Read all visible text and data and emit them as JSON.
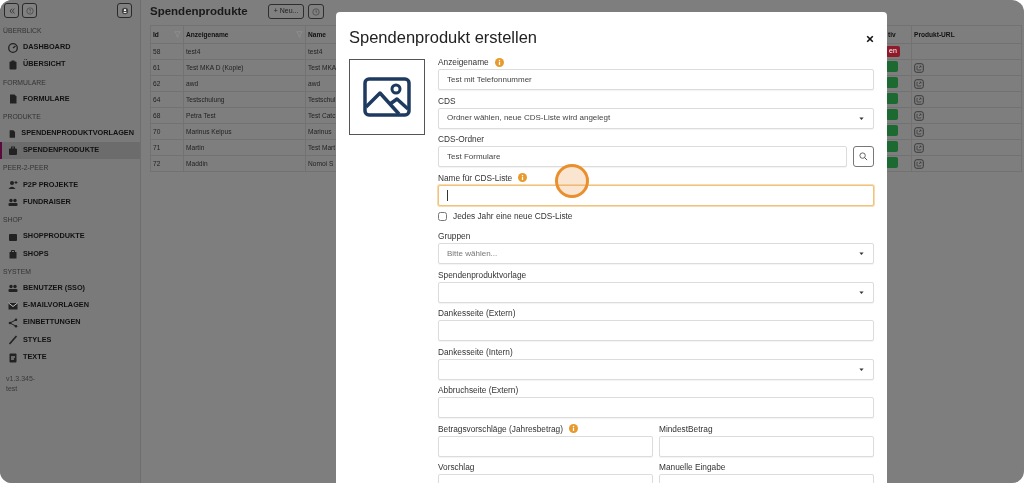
{
  "sidebar": {
    "sections": [
      {
        "title": "ÜBERBLICK",
        "items": [
          {
            "label": "DASHBOARD",
            "selected": false
          },
          {
            "label": "ÜBERSICHT",
            "selected": false
          }
        ]
      },
      {
        "title": "FORMULARE",
        "items": [
          {
            "label": "FORMULARE",
            "selected": false
          }
        ]
      },
      {
        "title": "PRODUKTE",
        "items": [
          {
            "label": "SPENDENPRODUKTVORLAGEN",
            "selected": false
          },
          {
            "label": "SPENDENPRODUKTE",
            "selected": true
          }
        ]
      },
      {
        "title": "PEER-2-PEER",
        "items": [
          {
            "label": "P2P PROJEKTE",
            "selected": false
          },
          {
            "label": "FUNDRAISER",
            "selected": false
          }
        ]
      },
      {
        "title": "SHOP",
        "items": [
          {
            "label": "SHOPPRODUKTE",
            "selected": false
          },
          {
            "label": "SHOPS",
            "selected": false
          }
        ]
      },
      {
        "title": "SYSTEM",
        "items": [
          {
            "label": "BENUTZER (SSO)",
            "selected": false
          },
          {
            "label": "E-MAILVORLAGEN",
            "selected": false
          },
          {
            "label": "EINBETTUNGEN",
            "selected": false
          },
          {
            "label": "STYLES",
            "selected": false
          },
          {
            "label": "TEXTE",
            "selected": false
          }
        ]
      }
    ],
    "version": "v1.3.345-test"
  },
  "main": {
    "title": "Spendenprodukte",
    "new_button": "+ Neu...",
    "table": {
      "columns": [
        {
          "label": "Id",
          "filter": true
        },
        {
          "label": "Anzeigename",
          "filter": true
        },
        {
          "label": "Name"
        },
        {
          "label": "tiv",
          "filter": false
        },
        {
          "label": "Produkt-URL",
          "filter": false
        }
      ],
      "rows": [
        {
          "id": "58",
          "display_name": "test4",
          "name": "test4",
          "status": {
            "text": "en",
            "color": "#8e1a2a"
          },
          "link": false
        },
        {
          "id": "61",
          "display_name": "Test MKA D (Kopie)",
          "name": "Test MKA",
          "status": {
            "color": "#1c6a32"
          },
          "link": true
        },
        {
          "id": "62",
          "display_name": "awd",
          "name": "awd",
          "status": {
            "color": "#1c6a32"
          },
          "link": true
        },
        {
          "id": "64",
          "display_name": "Testschulung",
          "name": "Testschul",
          "status": {
            "color": "#1c6a32"
          },
          "link": true
        },
        {
          "id": "68",
          "display_name": "Petra Test",
          "name": "Test Catc",
          "status": {
            "color": "#1c6a32"
          },
          "link": true
        },
        {
          "id": "70",
          "display_name": "Marinus Keipus",
          "name": "Marinus",
          "status": {
            "color": "#1c6a32"
          },
          "link": true
        },
        {
          "id": "71",
          "display_name": "Martin",
          "name": "Test Mart",
          "status": {
            "color": "#1c6a32"
          },
          "link": true
        },
        {
          "id": "72",
          "display_name": "Maddin",
          "name": "Nomoi S",
          "status": {
            "color": "#1c6a32"
          },
          "link": true
        }
      ]
    }
  },
  "modal": {
    "title": "Spendenprodukt erstellen",
    "fields": [
      {
        "kind": "text",
        "label": "Anzeigename",
        "info": true,
        "value": "Test mit Telefonnummer"
      },
      {
        "kind": "select",
        "label": "CDS",
        "info": false,
        "value": "Ordner wählen, neue CDS-Liste wird angelegt"
      },
      {
        "kind": "search",
        "label": "CDS-Ordner",
        "info": false,
        "value": "Test Formulare"
      },
      {
        "kind": "text",
        "label": "Name für CDS-Liste",
        "info": true,
        "focused": true
      },
      {
        "kind": "checkbox",
        "label": "Jedes Jahr eine neue CDS-Liste",
        "checked": false
      },
      {
        "kind": "select",
        "label": "Gruppen",
        "info": false,
        "placeholder": "Bitte wählen..."
      },
      {
        "kind": "select",
        "label": "Spendenproduktvorlage",
        "info": false
      },
      {
        "kind": "text",
        "label": "Dankesseite (Extern)",
        "info": false
      },
      {
        "kind": "select",
        "label": "Dankesseite (Intern)",
        "info": false
      },
      {
        "kind": "text",
        "label": "Abbruchseite (Extern)",
        "info": false
      },
      {
        "kind": "pair",
        "fields": [
          {
            "kind": "text",
            "label": "Betragsvorschläge (Jahresbetrag)",
            "info": true
          },
          {
            "kind": "text",
            "label": "MindestBetrag",
            "info": false
          }
        ]
      },
      {
        "kind": "pair",
        "fields": [
          {
            "kind": "text",
            "label": "Vorschlag",
            "info": false
          },
          {
            "kind": "text",
            "label": "Manuelle Eingabe",
            "info": false
          }
        ]
      }
    ]
  }
}
